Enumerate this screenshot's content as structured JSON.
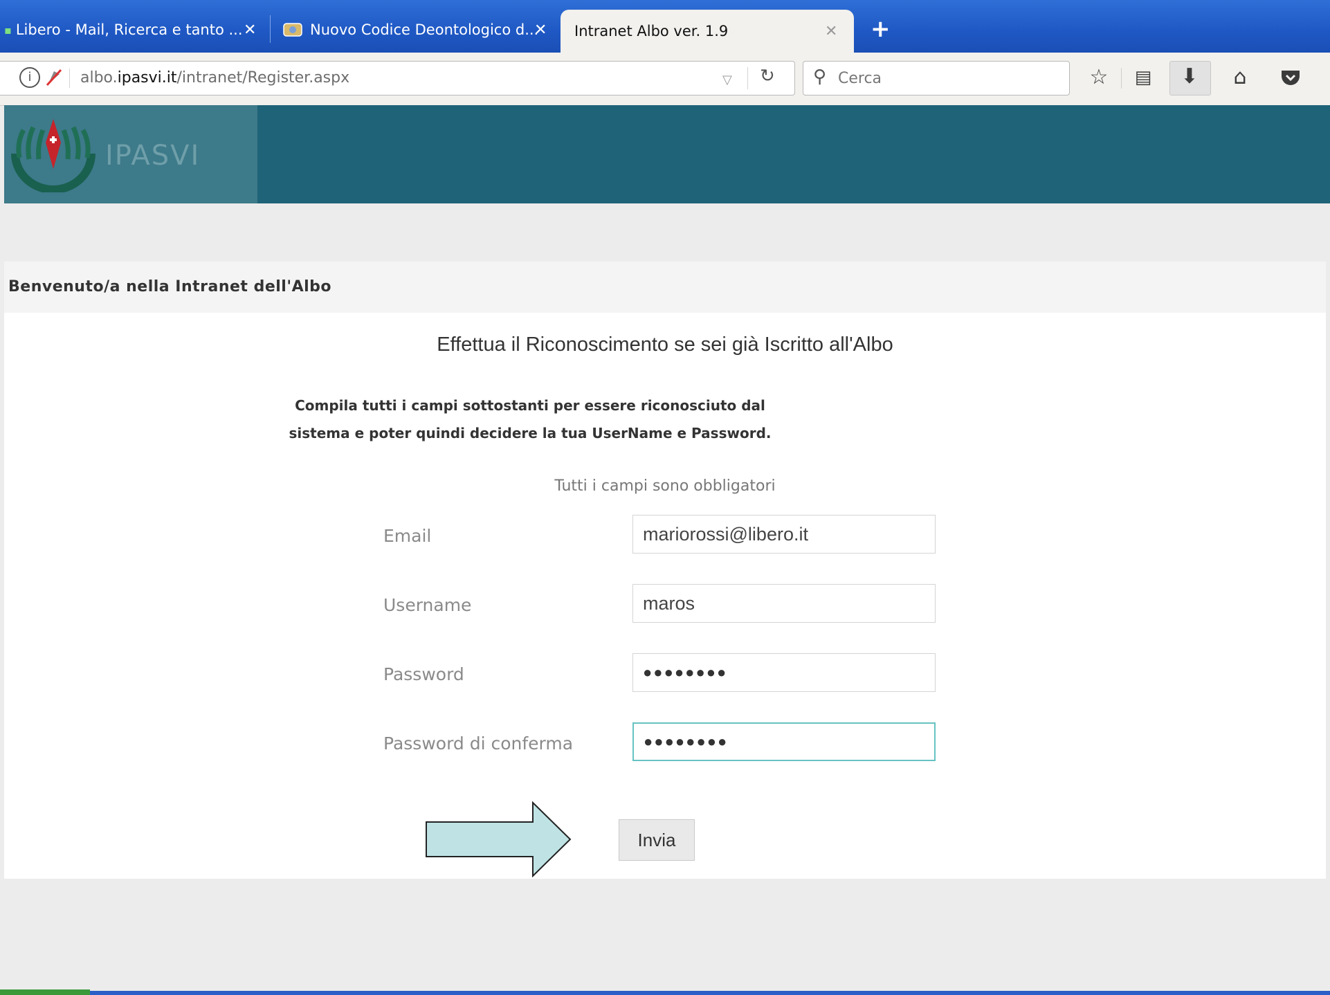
{
  "browser": {
    "tabs": [
      {
        "label": "Libero - Mail, Ricerca e tanto ..."
      },
      {
        "label": "Nuovo Codice Deontologico d..."
      },
      {
        "label": "Intranet Albo ver. 1.9"
      }
    ],
    "close_glyph": "✕",
    "new_tab_glyph": "+",
    "url": {
      "domain_prefix": "albo.",
      "domain_main": "ipasvi.it",
      "path": "/intranet/Register.aspx"
    },
    "search_placeholder": "Cerca",
    "toolbar_icons": [
      "star-icon",
      "reading-list-icon",
      "download-icon",
      "home-icon",
      "pocket-icon"
    ]
  },
  "header": {
    "logo_text": "IPASVI",
    "colors": {
      "bar": "#1e6377",
      "logo_box": "#3d7a8a"
    }
  },
  "page": {
    "welcome": "Benvenuto/a nella Intranet dell'Albo",
    "heading": "Effettua il Riconoscimento se sei già Iscritto all'Albo",
    "instructions": "Compila tutti i campi sottostanti per essere riconosciuto dal sistema e poter quindi decidere la tua UserName e Password.",
    "required_note": "Tutti i campi sono obbligatori",
    "fields": {
      "email": {
        "label": "Email",
        "value": "mariorossi@libero.it"
      },
      "username": {
        "label": "Username",
        "value": "maros"
      },
      "password": {
        "label": "Password",
        "value": "●●●●●●●●"
      },
      "password_confirm": {
        "label": "Password di conferma",
        "value": "●●●●●●●●"
      }
    },
    "submit_label": "Invia",
    "annotation_arrow_color": "#bfe3e4"
  }
}
